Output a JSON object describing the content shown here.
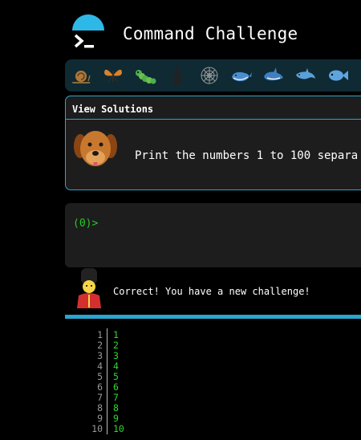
{
  "header": {
    "title": "Command Challenge",
    "logo_icon": "terminal-prompt-icon"
  },
  "icon_bar": {
    "items": [
      {
        "name": "snail-icon"
      },
      {
        "name": "butterfly-icon"
      },
      {
        "name": "caterpillar-icon"
      },
      {
        "name": "ant-icon"
      },
      {
        "name": "spiderweb-icon"
      },
      {
        "name": "whale-icon"
      },
      {
        "name": "orca-icon"
      },
      {
        "name": "dolphin-icon"
      },
      {
        "name": "fish-icon"
      }
    ]
  },
  "challenge_card": {
    "header_label": "View Solutions",
    "avatar": "dog-icon",
    "text": "Print the numbers 1 to 100 separa"
  },
  "terminal": {
    "prompt": "(0)>"
  },
  "feedback": {
    "avatar": "royal-guard-icon",
    "message": "Correct! You have a new challenge!"
  },
  "output": {
    "lines": [
      {
        "n": "1",
        "v": "1"
      },
      {
        "n": "2",
        "v": "2"
      },
      {
        "n": "3",
        "v": "3"
      },
      {
        "n": "4",
        "v": "4"
      },
      {
        "n": "5",
        "v": "5"
      },
      {
        "n": "6",
        "v": "6"
      },
      {
        "n": "7",
        "v": "7"
      },
      {
        "n": "8",
        "v": "8"
      },
      {
        "n": "9",
        "v": "9"
      },
      {
        "n": "10",
        "v": "10"
      }
    ]
  },
  "colors": {
    "accent": "#2aa6cf",
    "prompt_green": "#28c828",
    "output_green": "#2ed82e",
    "panel": "#1d1d1d"
  }
}
